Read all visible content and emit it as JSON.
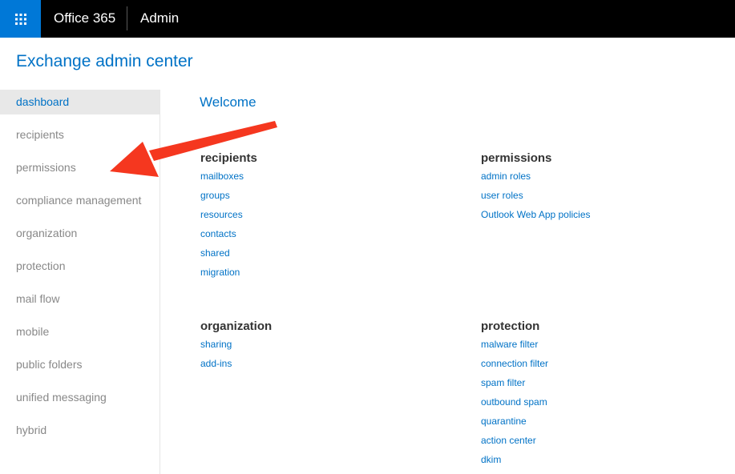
{
  "topbar": {
    "app_name": "Office 365",
    "section": "Admin",
    "accent": "#0078d7",
    "launcher_icon": "app-launcher-icon"
  },
  "page_title": "Exchange admin center",
  "sidebar": {
    "active": "dashboard",
    "items": [
      {
        "label": "dashboard"
      },
      {
        "label": "recipients"
      },
      {
        "label": "permissions"
      },
      {
        "label": "compliance management"
      },
      {
        "label": "organization"
      },
      {
        "label": "protection"
      },
      {
        "label": "mail flow"
      },
      {
        "label": "mobile"
      },
      {
        "label": "public folders"
      },
      {
        "label": "unified messaging"
      },
      {
        "label": "hybrid"
      }
    ]
  },
  "main": {
    "welcome": "Welcome",
    "groups": {
      "recipients": {
        "title": "recipients",
        "links": [
          "mailboxes",
          "groups",
          "resources",
          "contacts",
          "shared",
          "migration"
        ]
      },
      "permissions": {
        "title": "permissions",
        "links": [
          "admin roles",
          "user roles",
          "Outlook Web App policies"
        ]
      },
      "organization": {
        "title": "organization",
        "links": [
          "sharing",
          "add-ins"
        ]
      },
      "protection": {
        "title": "protection",
        "links": [
          "malware filter",
          "connection filter",
          "spam filter",
          "outbound spam",
          "quarantine",
          "action center",
          "dkim"
        ]
      }
    }
  },
  "annotation": {
    "type": "arrow",
    "color": "#f5371f",
    "points_to": "permissions"
  }
}
